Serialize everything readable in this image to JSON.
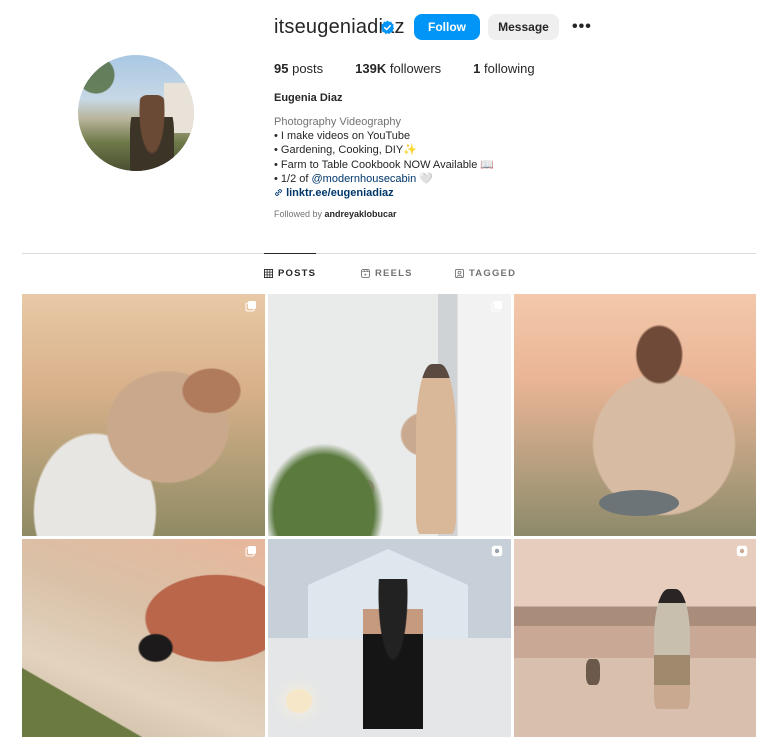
{
  "profile": {
    "username": "itseugeniadiaz",
    "verified": true,
    "follow_label": "Follow",
    "message_label": "Message",
    "more_label": "•••",
    "stats": {
      "posts_count": "95",
      "posts_label": "posts",
      "followers_count": "139K",
      "followers_label": "followers",
      "following_count": "1",
      "following_label": "following"
    },
    "full_name": "Eugenia Diaz",
    "category": "Photography Videography",
    "bio_lines": [
      "• I make videos on YouTube",
      "• Gardening, Cooking, DIY✨",
      "• Farm to Table Cookbook NOW Available 📖",
      "• 1/2 of ",
      "@modernhousecabin",
      " 🤍"
    ],
    "link": "linktr.ee/eugeniadiaz",
    "followed_by_prefix": "Followed by ",
    "followed_by_user": "andreyaklobucar"
  },
  "tabs": [
    {
      "label": "POSTS",
      "active": true,
      "icon": "grid-icon"
    },
    {
      "label": "REELS",
      "active": false,
      "icon": "reels-icon"
    },
    {
      "label": "TAGGED",
      "active": false,
      "icon": "tagged-icon"
    }
  ],
  "colors": {
    "primary_button": "#0095f6",
    "secondary_button": "#efefef",
    "verified_badge": "#0095f6",
    "link": "#00376b",
    "muted_text": "#737373",
    "divider": "#dbdbdb"
  },
  "posts": [
    {
      "badge": "carousel-icon"
    },
    {
      "badge": "carousel-icon"
    },
    {
      "badge": "none"
    },
    {
      "badge": "carousel-icon"
    },
    {
      "badge": "reel-icon"
    },
    {
      "badge": "reel-icon"
    }
  ]
}
